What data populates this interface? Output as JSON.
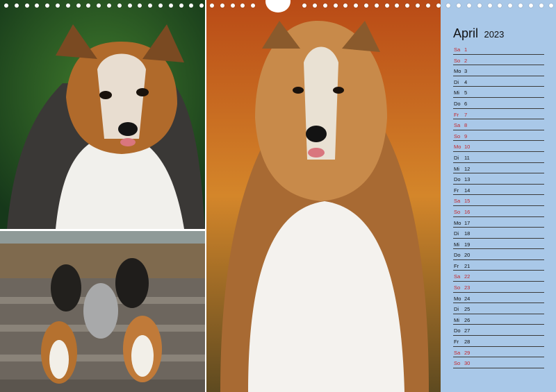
{
  "calendar": {
    "month": "April",
    "year": "2023",
    "days": [
      {
        "wd": "Sa",
        "d": "1",
        "weekend": true
      },
      {
        "wd": "So",
        "d": "2",
        "weekend": true
      },
      {
        "wd": "Mo",
        "d": "3",
        "weekend": false
      },
      {
        "wd": "Di",
        "d": "4",
        "weekend": false
      },
      {
        "wd": "Mi",
        "d": "5",
        "weekend": false
      },
      {
        "wd": "Do",
        "d": "6",
        "weekend": false
      },
      {
        "wd": "Fr",
        "d": "7",
        "weekend": true
      },
      {
        "wd": "Sa",
        "d": "8",
        "weekend": true
      },
      {
        "wd": "So",
        "d": "9",
        "weekend": true
      },
      {
        "wd": "Mo",
        "d": "10",
        "weekend": true
      },
      {
        "wd": "Di",
        "d": "11",
        "weekend": false
      },
      {
        "wd": "Mi",
        "d": "12",
        "weekend": false
      },
      {
        "wd": "Do",
        "d": "13",
        "weekend": false
      },
      {
        "wd": "Fr",
        "d": "14",
        "weekend": false
      },
      {
        "wd": "Sa",
        "d": "15",
        "weekend": true
      },
      {
        "wd": "So",
        "d": "16",
        "weekend": true
      },
      {
        "wd": "Mo",
        "d": "17",
        "weekend": false
      },
      {
        "wd": "Di",
        "d": "18",
        "weekend": false
      },
      {
        "wd": "Mi",
        "d": "19",
        "weekend": false
      },
      {
        "wd": "Do",
        "d": "20",
        "weekend": false
      },
      {
        "wd": "Fr",
        "d": "21",
        "weekend": false
      },
      {
        "wd": "Sa",
        "d": "22",
        "weekend": true
      },
      {
        "wd": "So",
        "d": "23",
        "weekend": true
      },
      {
        "wd": "Mo",
        "d": "24",
        "weekend": false
      },
      {
        "wd": "Di",
        "d": "25",
        "weekend": false
      },
      {
        "wd": "Mi",
        "d": "26",
        "weekend": false
      },
      {
        "wd": "Do",
        "d": "27",
        "weekend": false
      },
      {
        "wd": "Fr",
        "d": "28",
        "weekend": false
      },
      {
        "wd": "Sa",
        "d": "29",
        "weekend": true
      },
      {
        "wd": "So",
        "d": "30",
        "weekend": true
      }
    ]
  },
  "colors": {
    "panel": "#a9c8e8",
    "weekend": "#c4242a",
    "weekday": "#111111",
    "rule": "#3b3b3b"
  },
  "photos": [
    {
      "icon": "sheltie-portrait-photo"
    },
    {
      "icon": "dog-group-on-steps-photo"
    },
    {
      "icon": "collie-portrait-photo"
    }
  ]
}
